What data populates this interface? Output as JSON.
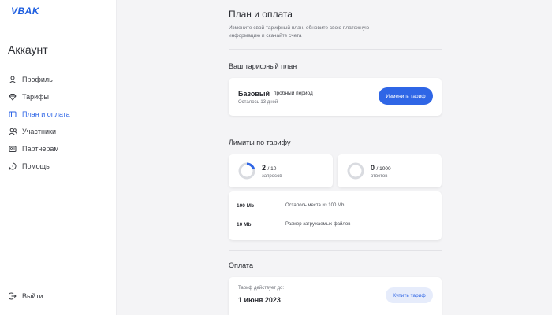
{
  "app": {
    "logo": "VBAK"
  },
  "sidebar": {
    "title": "Аккаунт",
    "items": [
      {
        "label": "Профиль",
        "icon": "person-icon",
        "active": false
      },
      {
        "label": "Тарифы",
        "icon": "diamond-icon",
        "active": false
      },
      {
        "label": "План и оплата",
        "icon": "card-icon",
        "active": true
      },
      {
        "label": "Участники",
        "icon": "users-icon",
        "active": false
      },
      {
        "label": "Партнерам",
        "icon": "partner-icon",
        "active": false
      },
      {
        "label": "Помощь",
        "icon": "help-icon",
        "active": false
      }
    ],
    "logout": "Выйти"
  },
  "header": {
    "title": "План и оплата",
    "subtitle": "Измените свой тарифный план, обновите свою платежную информацию и скачайте счета"
  },
  "plan": {
    "section_title": "Ваш тарифный план",
    "name": "Базовый",
    "period": "пробный период",
    "days_left": "Осталось 13 дней",
    "change_button": "Изменить тариф"
  },
  "limits": {
    "section_title": "Лимиты по тарифу",
    "requests": {
      "used": "2",
      "total": "/ 10",
      "label": "запросов",
      "fraction": 0.2
    },
    "answers": {
      "used": "0",
      "total": "/ 1000",
      "label": "ответов",
      "fraction": 0
    },
    "storage": [
      {
        "value": "100 Mb",
        "desc": "Осталось места из 100 Mb"
      },
      {
        "value": "10 Mb",
        "desc": "Размер загружаемых файлов"
      }
    ]
  },
  "payment": {
    "section_title": "Оплата",
    "label": "Тариф действует до:",
    "date": "1 июня 2023",
    "buy_button": "Купить тариф"
  },
  "colors": {
    "accent": "#2f66e6",
    "ring_track": "#d9dbe0"
  }
}
